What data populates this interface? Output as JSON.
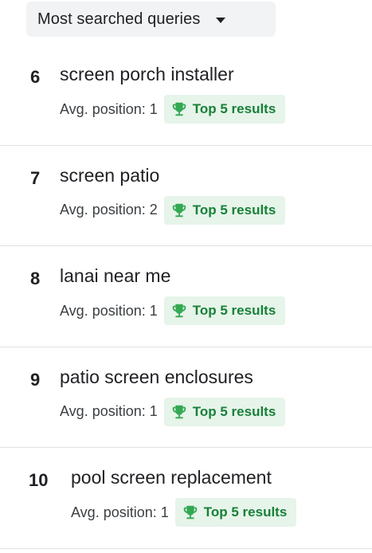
{
  "header": {
    "dropdown_label": "Most searched queries"
  },
  "colors": {
    "badge_text": "#188038",
    "badge_bg": "#e6f4ea",
    "trophy": "#34a853"
  },
  "queries": [
    {
      "rank": "6",
      "text": "screen porch installer",
      "avg_position": "Avg. position: 1",
      "badge": "Top 5 results",
      "badge_icon": "trophy-icon"
    },
    {
      "rank": "7",
      "text": "screen patio",
      "avg_position": "Avg. position: 2",
      "badge": "Top 5 results",
      "badge_icon": "trophy-icon"
    },
    {
      "rank": "8",
      "text": "lanai near me",
      "avg_position": "Avg. position: 1",
      "badge": "Top 5 results",
      "badge_icon": "trophy-icon"
    },
    {
      "rank": "9",
      "text": "patio screen enclosures",
      "avg_position": "Avg. position: 1",
      "badge": "Top 5 results",
      "badge_icon": "trophy-icon"
    },
    {
      "rank": "10",
      "text": "pool screen replacement",
      "avg_position": "Avg. position: 1",
      "badge": "Top 5 results",
      "badge_icon": "trophy-icon"
    }
  ]
}
